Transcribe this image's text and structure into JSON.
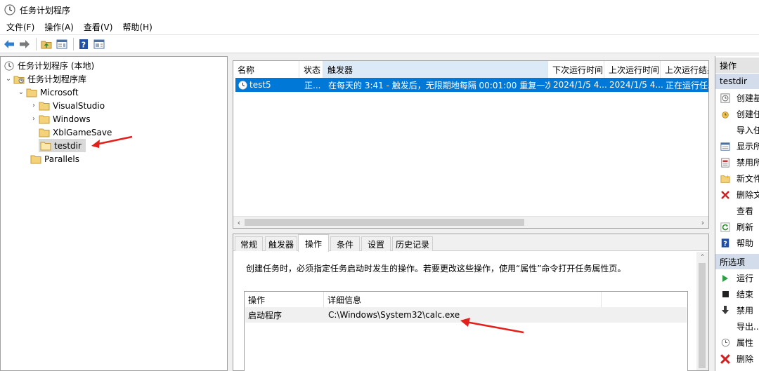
{
  "window": {
    "title": "任务计划程序"
  },
  "menu": [
    "文件(F)",
    "操作(A)",
    "查看(V)",
    "帮助(H)"
  ],
  "tree": {
    "root": "任务计划程序 (本地)",
    "library": "任务计划程序库",
    "microsoft": "Microsoft",
    "visualstudio": "VisualStudio",
    "windows": "Windows",
    "xblgamesave": "XblGameSave",
    "testdir": "testdir",
    "parallels": "Parallels"
  },
  "task_list": {
    "columns": [
      "名称",
      "状态",
      "触发器",
      "下次运行时间",
      "上次运行时间",
      "上次运行结果"
    ],
    "rows": [
      {
        "name": "test5",
        "status": "正...",
        "trigger": "在每天的 3:41 - 触发后，无限期地每隔 00:01:00 重复一次。",
        "next_run": "2024/1/5 4...",
        "last_run": "2024/1/5 4...",
        "last_result": "正在运行任..."
      }
    ]
  },
  "detail": {
    "tabs": [
      "常规",
      "触发器",
      "操作",
      "条件",
      "设置",
      "历史记录"
    ],
    "active_tab": "操作",
    "description": "创建任务时，必须指定任务启动时发生的操作。若要更改这些操作，使用“属性”命令打开任务属性页。",
    "actions_table": {
      "columns": [
        "操作",
        "详细信息"
      ],
      "rows": [
        {
          "action": "启动程序",
          "detail": "C:\\Windows\\System32\\calc.exe"
        }
      ]
    }
  },
  "actions_pane": {
    "header": "操作",
    "folder_header": "testdir",
    "folder_items": [
      "创建基",
      "创建任",
      "导入任",
      "显示所",
      "禁用所",
      "新文件",
      "删除文",
      "查看",
      "刷新",
      "帮助"
    ],
    "selected_header": "所选项",
    "selected_items": [
      "运行",
      "结束",
      "禁用",
      "导出...",
      "属性",
      "删除"
    ]
  },
  "colors": {
    "selection": "#0078d7",
    "annotation_arrow": "#e3201b"
  }
}
